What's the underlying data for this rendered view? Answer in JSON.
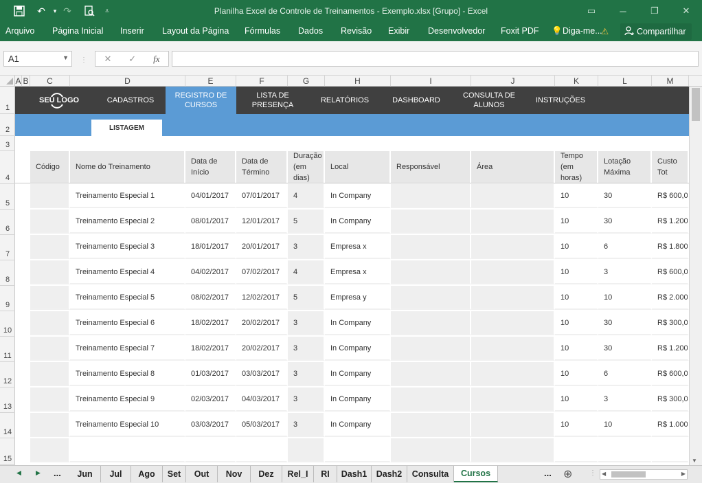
{
  "window": {
    "title": "Planilha Excel de Controle de Treinamentos - Exemplo.xlsx  [Grupo] - Excel"
  },
  "ribbon": {
    "tabs": [
      "Arquivo",
      "Página Inicial",
      "Inserir",
      "Layout da Página",
      "Fórmulas",
      "Dados",
      "Revisão",
      "Exibir",
      "Desenvolvedor",
      "Foxit PDF"
    ],
    "tell_me": "Diga-me...",
    "share": "Compartilhar"
  },
  "formula_bar": {
    "name_box": "A1",
    "fx": "fx",
    "cancel": "✕",
    "enter": "✓",
    "value": ""
  },
  "columns": [
    "A",
    "B",
    "C",
    "D",
    "E",
    "F",
    "G",
    "H",
    "I",
    "J",
    "K",
    "L",
    "M"
  ],
  "rows": [
    "1",
    "2",
    "3",
    "4",
    "5",
    "6",
    "7",
    "8",
    "9",
    "10",
    "11",
    "12",
    "13",
    "14",
    "15"
  ],
  "nav": {
    "logo": "SEU LOGO",
    "items": [
      "CADASTROS",
      "REGISTRO DE CURSOS",
      "LISTA DE PRESENÇA",
      "RELATÓRIOS",
      "DASHBOARD",
      "CONSULTA DE ALUNOS",
      "INSTRUÇÕES"
    ],
    "active": "REGISTRO DE CURSOS",
    "sub_tab": "LISTAGEM"
  },
  "table": {
    "headers": [
      "Código",
      "Nome do Treinamento",
      "Data de Início",
      "Data de Término",
      "Duração (em dias)",
      "Local",
      "Responsável",
      "Área",
      "Tempo (em horas)",
      "Lotação Máxima",
      "Custo Tot"
    ],
    "rows": [
      [
        "",
        "Treinamento Especial 1",
        "04/01/2017",
        "07/01/2017",
        "4",
        "In Company",
        "",
        "",
        "10",
        "30",
        "R$ 600,0"
      ],
      [
        "",
        "Treinamento Especial 2",
        "08/01/2017",
        "12/01/2017",
        "5",
        "In Company",
        "",
        "",
        "10",
        "30",
        "R$ 1.200,"
      ],
      [
        "",
        "Treinamento Especial 3",
        "18/01/2017",
        "20/01/2017",
        "3",
        "Empresa x",
        "",
        "",
        "10",
        "6",
        "R$ 1.800,"
      ],
      [
        "",
        "Treinamento Especial 4",
        "04/02/2017",
        "07/02/2017",
        "4",
        "Empresa x",
        "",
        "",
        "10",
        "3",
        "R$ 600,0"
      ],
      [
        "",
        "Treinamento Especial 5",
        "08/02/2017",
        "12/02/2017",
        "5",
        "Empresa y",
        "",
        "",
        "10",
        "10",
        "R$ 2.000"
      ],
      [
        "",
        "Treinamento Especial 6",
        "18/02/2017",
        "20/02/2017",
        "3",
        "In Company",
        "",
        "",
        "10",
        "30",
        "R$ 300,0"
      ],
      [
        "",
        "Treinamento Especial 7",
        "18/02/2017",
        "20/02/2017",
        "3",
        "In Company",
        "",
        "",
        "10",
        "30",
        "R$ 1.200,"
      ],
      [
        "",
        "Treinamento Especial 8",
        "01/03/2017",
        "03/03/2017",
        "3",
        "In Company",
        "",
        "",
        "10",
        "6",
        "R$ 600,0"
      ],
      [
        "",
        "Treinamento Especial 9",
        "02/03/2017",
        "04/03/2017",
        "3",
        "In Company",
        "",
        "",
        "10",
        "3",
        "R$ 300,0"
      ],
      [
        "",
        "Treinamento Especial 10",
        "03/03/2017",
        "05/03/2017",
        "3",
        "In Company",
        "",
        "",
        "10",
        "10",
        "R$ 1.000,"
      ],
      [
        "",
        "",
        "",
        "",
        "",
        "",
        "",
        "",
        "",
        "",
        ""
      ]
    ]
  },
  "sheets": {
    "items": [
      "Jun",
      "Jul",
      "Ago",
      "Set",
      "Out",
      "Nov",
      "Dez",
      "Rel_I",
      "RI",
      "Dash1",
      "Dash2",
      "Consulta",
      "Cursos"
    ],
    "selected": "Cursos",
    "more": "...",
    "add": "⊕"
  },
  "colors": {
    "excel_green": "#217346",
    "nav_dark": "#404040",
    "accent_blue": "#5b9bd5",
    "header_gray": "#e7e7e7"
  }
}
